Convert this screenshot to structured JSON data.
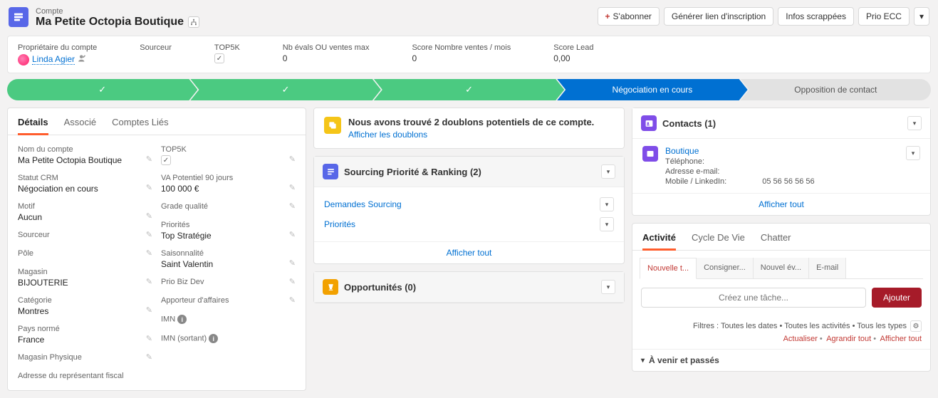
{
  "header": {
    "type_label": "Compte",
    "name": "Ma Petite Octopia Boutique",
    "actions": {
      "follow": "S'abonner",
      "gen_link": "Générer lien d'inscription",
      "infos": "Infos scrappées",
      "prio": "Prio ECC"
    }
  },
  "highlights": {
    "owner_label": "Propriétaire du compte",
    "owner_value": "Linda Agier",
    "sourceur_label": "Sourceur",
    "sourceur_value": "",
    "top5k_label": "TOP5K",
    "top5k_checked": true,
    "nb_evals_label": "Nb évals OU ventes max",
    "nb_evals_value": "0",
    "score_nv_label": "Score Nombre ventes / mois",
    "score_nv_value": "0",
    "score_lead_label": "Score Lead",
    "score_lead_value": "0,00"
  },
  "path": {
    "steps": [
      "",
      "",
      "",
      ""
    ],
    "current": "Négociation en cours",
    "future": "Opposition de contact"
  },
  "tabs_left": {
    "details": "Détails",
    "associe": "Associé",
    "comptes_lies": "Comptes Liés"
  },
  "details_left": {
    "nom_label": "Nom du compte",
    "nom_value": "Ma Petite Octopia Boutique",
    "statut_label": "Statut CRM",
    "statut_value": "Négociation en cours",
    "motif_label": "Motif",
    "motif_value": "Aucun",
    "sourceur_label": "Sourceur",
    "sourceur_value": "",
    "pole_label": "Pôle",
    "pole_value": "",
    "magasin_label": "Magasin",
    "magasin_value": "BIJOUTERIE",
    "categorie_label": "Catégorie",
    "categorie_value": "Montres",
    "pays_label": "Pays normé",
    "pays_value": "France",
    "magphys_label": "Magasin Physique",
    "magphys_value": "",
    "adresse_rep_label": "Adresse du représentant fiscal"
  },
  "details_right": {
    "top5k_label": "TOP5K",
    "va_label": "VA Potentiel 90 jours",
    "va_value": "100 000 €",
    "grade_label": "Grade qualité",
    "grade_value": "",
    "priorites_label": "Priorités",
    "priorites_value": "Top Stratégie",
    "saison_label": "Saisonnalité",
    "saison_value": "Saint Valentin",
    "priobiz_label": "Prio Biz Dev",
    "priobiz_value": "",
    "apporteur_label": "Apporteur d'affaires",
    "apporteur_value": "",
    "imn_label": "IMN",
    "imn_value": "",
    "imnout_label": "IMN (sortant)",
    "imnout_value": ""
  },
  "dup": {
    "title": "Nous avons trouvé 2 doublons potentiels de ce compte.",
    "link": "Afficher les doublons"
  },
  "sourcing": {
    "title": "Sourcing Priorité & Ranking (2)",
    "rows": {
      "r1": "Demandes Sourcing",
      "r2": "Priorités"
    },
    "footer": "Afficher tout"
  },
  "opp": {
    "title": "Opportunités (0)"
  },
  "contacts": {
    "title": "Contacts (1)",
    "name": "Boutique",
    "tel_label": "Téléphone:",
    "email_label": "Adresse e-mail:",
    "mobile_label": "Mobile / LinkedIn:",
    "mobile_value": "05 56 56 56 56",
    "footer": "Afficher tout"
  },
  "activity": {
    "tabs": {
      "activite": "Activité",
      "cycle": "Cycle De Vie",
      "chatter": "Chatter"
    },
    "subtabs": {
      "nt": "Nouvelle t...",
      "cons": "Consigner...",
      "nev": "Nouvel év...",
      "email": "E-mail"
    },
    "placeholder": "Créez une tâche...",
    "add": "Ajouter",
    "filters": "Filtres : Toutes les dates • Toutes les activités • Tous les types",
    "links": {
      "a": "Actualiser",
      "b": "Agrandir tout",
      "c": "Afficher tout"
    },
    "upcoming": "À venir et passés"
  }
}
